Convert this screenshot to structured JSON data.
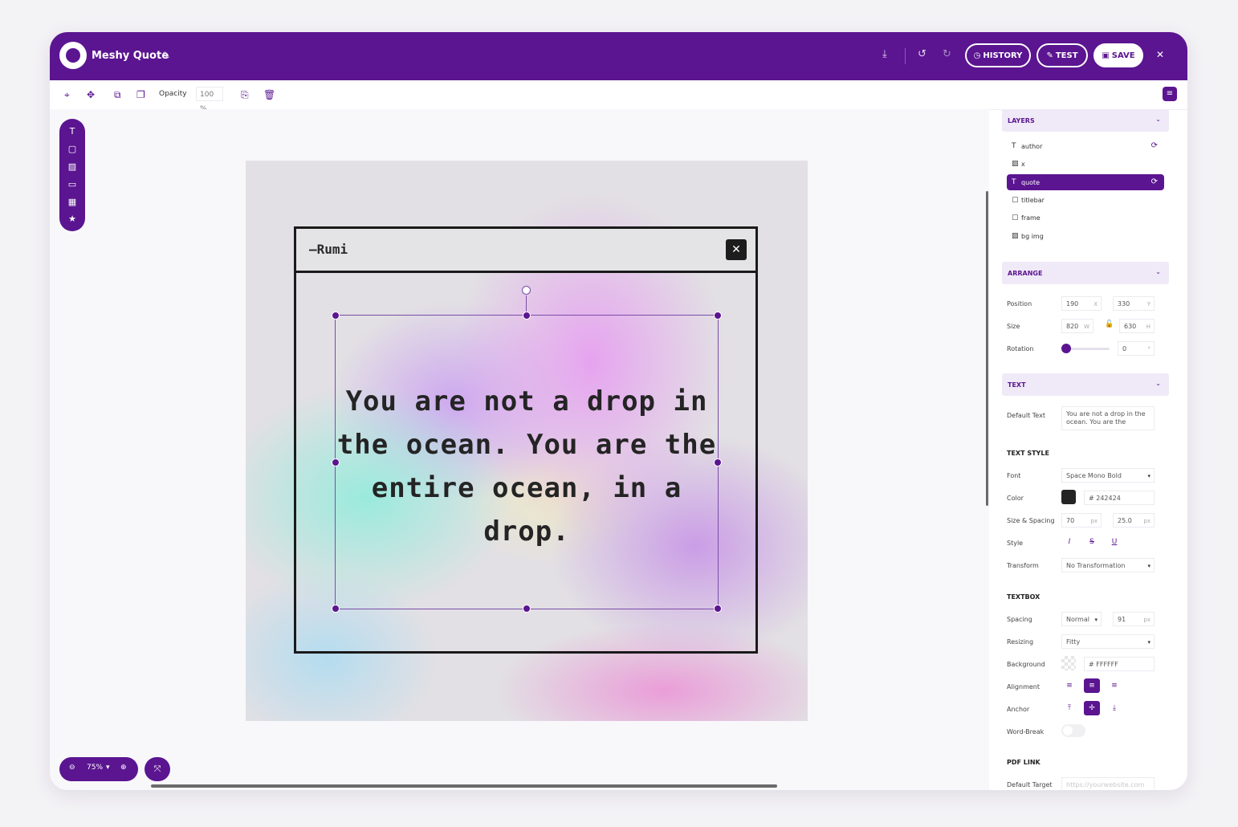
{
  "app": {
    "title": "Meshy Quote"
  },
  "header": {
    "history": "HISTORY",
    "test": "TEST",
    "save": "SAVE"
  },
  "toolbar": {
    "opacity_label": "Opacity",
    "opacity_value": "100 %"
  },
  "canvas": {
    "author": "—Rumi",
    "quote": "You are not a drop in the ocean. You are the entire ocean, in a drop."
  },
  "zoom": {
    "level": "75%"
  },
  "panel": {
    "layers": {
      "title": "LAYERS",
      "items": [
        {
          "label": "author",
          "icon": "text-icon"
        },
        {
          "label": "x",
          "icon": "image-icon"
        },
        {
          "label": "quote",
          "icon": "text-icon"
        },
        {
          "label": "titlebar",
          "icon": "rectangle-icon"
        },
        {
          "label": "frame",
          "icon": "rectangle-icon"
        },
        {
          "label": "bg img",
          "icon": "image-icon"
        }
      ]
    },
    "arrange": {
      "title": "ARRANGE",
      "position_label": "Position",
      "x": "190",
      "x_unit": "X",
      "y": "330",
      "y_unit": "Y",
      "size_label": "Size",
      "w": "820",
      "w_unit": "W",
      "h": "630",
      "h_unit": "H",
      "rotation_label": "Rotation",
      "rotation": "0",
      "rotation_unit": "°"
    },
    "text": {
      "title": "TEXT",
      "default_text_label": "Default Text",
      "default_text": "You are not a drop in the ocean. You are the",
      "style_title": "TEXT STYLE",
      "font_label": "Font",
      "font": "Space Mono Bold",
      "color_label": "Color",
      "color": "# 242424",
      "size_spacing_label": "Size & Spacing",
      "size": "70",
      "size_unit": "px",
      "spacing": "25.0",
      "spacing_unit": "px",
      "style_label": "Style",
      "transform_label": "Transform",
      "transform": "No Transformation"
    },
    "textbox": {
      "title": "TEXTBOX",
      "spacing_label": "Spacing",
      "spacing_mode": "Normal",
      "spacing_value": "91",
      "spacing_unit": "px",
      "resizing_label": "Resizing",
      "resizing": "Fitty",
      "background_label": "Background",
      "background": "# FFFFFF",
      "alignment_label": "Alignment",
      "anchor_label": "Anchor",
      "word_break_label": "Word-Break"
    },
    "pdf_link": {
      "title": "PDF LINK",
      "default_target_label": "Default Target",
      "default_target_placeholder": "https://yourwebsite.com"
    }
  },
  "colors": {
    "brand": "#5b1590",
    "text_color": "#242424"
  }
}
